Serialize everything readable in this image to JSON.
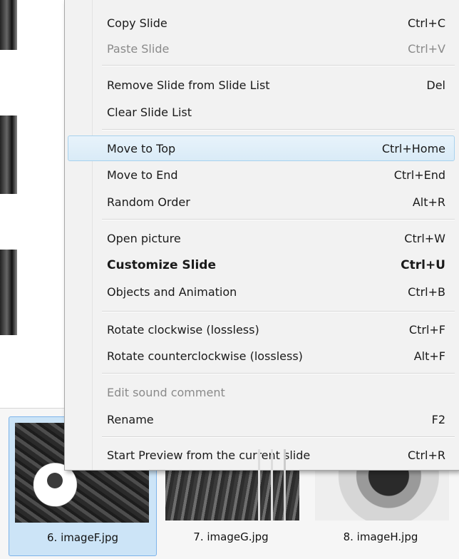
{
  "context_menu": {
    "items": [
      {
        "label": "Copy Slide",
        "shortcut": "Ctrl+C"
      },
      {
        "label": "Paste Slide",
        "shortcut": "Ctrl+V",
        "state": "disabled"
      },
      {
        "label": "Remove Slide from Slide List",
        "shortcut": "Del"
      },
      {
        "label": "Clear Slide List",
        "shortcut": ""
      },
      {
        "label": "Move to Top",
        "shortcut": "Ctrl+Home",
        "state": "hover"
      },
      {
        "label": "Move to End",
        "shortcut": "Ctrl+End"
      },
      {
        "label": "Random Order",
        "shortcut": "Alt+R"
      },
      {
        "label": "Open picture",
        "shortcut": "Ctrl+W"
      },
      {
        "label": "Customize Slide",
        "shortcut": "Ctrl+U",
        "state": "default-bold"
      },
      {
        "label": "Objects and Animation",
        "shortcut": "Ctrl+B"
      },
      {
        "label": "Rotate clockwise (lossless)",
        "shortcut": "Ctrl+F"
      },
      {
        "label": "Rotate counterclockwise (lossless)",
        "shortcut": "Alt+F"
      },
      {
        "label": "Edit sound comment",
        "shortcut": "",
        "state": "disabled"
      },
      {
        "label": "Rename",
        "shortcut": "F2"
      },
      {
        "label": "Start Preview from the current slide",
        "shortcut": "Ctrl+R"
      }
    ]
  },
  "slides": [
    {
      "caption": "6. imageF.jpg",
      "selected": true
    },
    {
      "caption": "7. imageG.jpg",
      "selected": false
    },
    {
      "caption": "8. imageH.jpg",
      "selected": false
    }
  ],
  "colors": {
    "menu_background": "#f2f2f2",
    "hover_border": "#a8d2ee",
    "selection_background": "#cce4f7",
    "disabled_text": "#8a8a8a"
  }
}
